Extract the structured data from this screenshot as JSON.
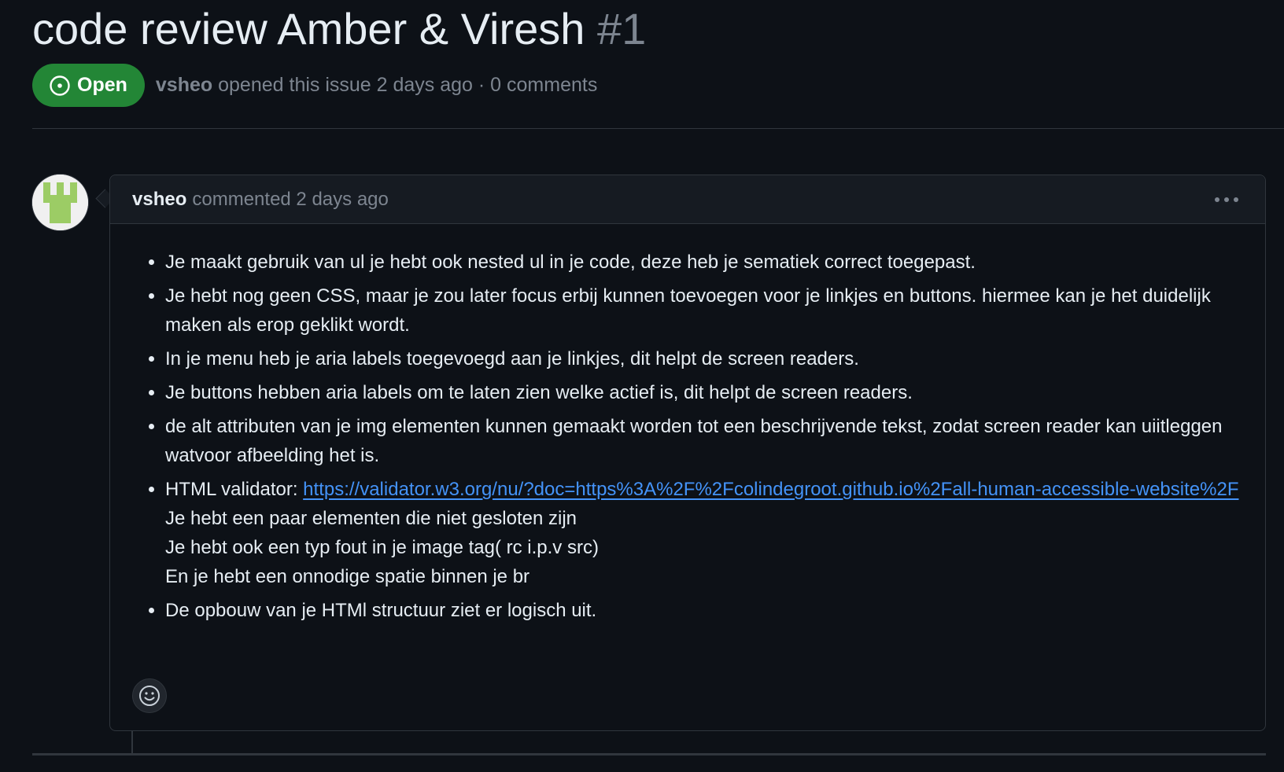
{
  "issue": {
    "title": "code review Amber & Viresh",
    "number": "#1",
    "state": "Open",
    "author": "vsheo",
    "opened_text": "opened this issue 2 days ago · 0 comments"
  },
  "comment": {
    "author": "vsheo",
    "timestamp": "commented 2 days ago",
    "items": [
      "Je maakt gebruik van ul je hebt ook nested ul in je code, deze heb je sematiek correct toegepast.",
      "Je hebt nog geen CSS, maar je zou later focus erbij kunnen toevoegen voor je linkjes en buttons. hiermee kan je het duidelijk maken als erop geklikt wordt.",
      "In je menu heb je aria labels toegevoegd aan je linkjes, dit helpt de screen readers.",
      "Je buttons hebben aria labels om te laten zien welke actief is, dit helpt de screen readers.",
      "de alt attributen van je img elementen kunnen gemaakt worden tot een beschrijvende tekst, zodat screen reader kan uiitleggen watvoor afbeelding het is."
    ],
    "validator": {
      "label": "HTML validator:",
      "link": "https://validator.w3.org/nu/?doc=https%3A%2F%2Fcolindegroot.github.io%2Fall-human-accessible-website%2F",
      "lines": [
        "Je hebt een paar elementen die niet gesloten zijn",
        "Je hebt ook een typ fout in je image tag( rc i.p.v src)",
        "En je hebt een onnodige spatie binnen je br"
      ]
    },
    "last_item": "De opbouw van je HTMl structuur ziet er logisch uit."
  },
  "icons": {
    "state": "issue-opened-icon",
    "menu": "kebab-horizontal-icon",
    "reaction": "smiley-icon"
  },
  "colors": {
    "background": "#0d1117",
    "open_badge": "#238636",
    "link": "#4493f8",
    "muted": "#7d8590",
    "avatar_green": "#9ccc65"
  }
}
